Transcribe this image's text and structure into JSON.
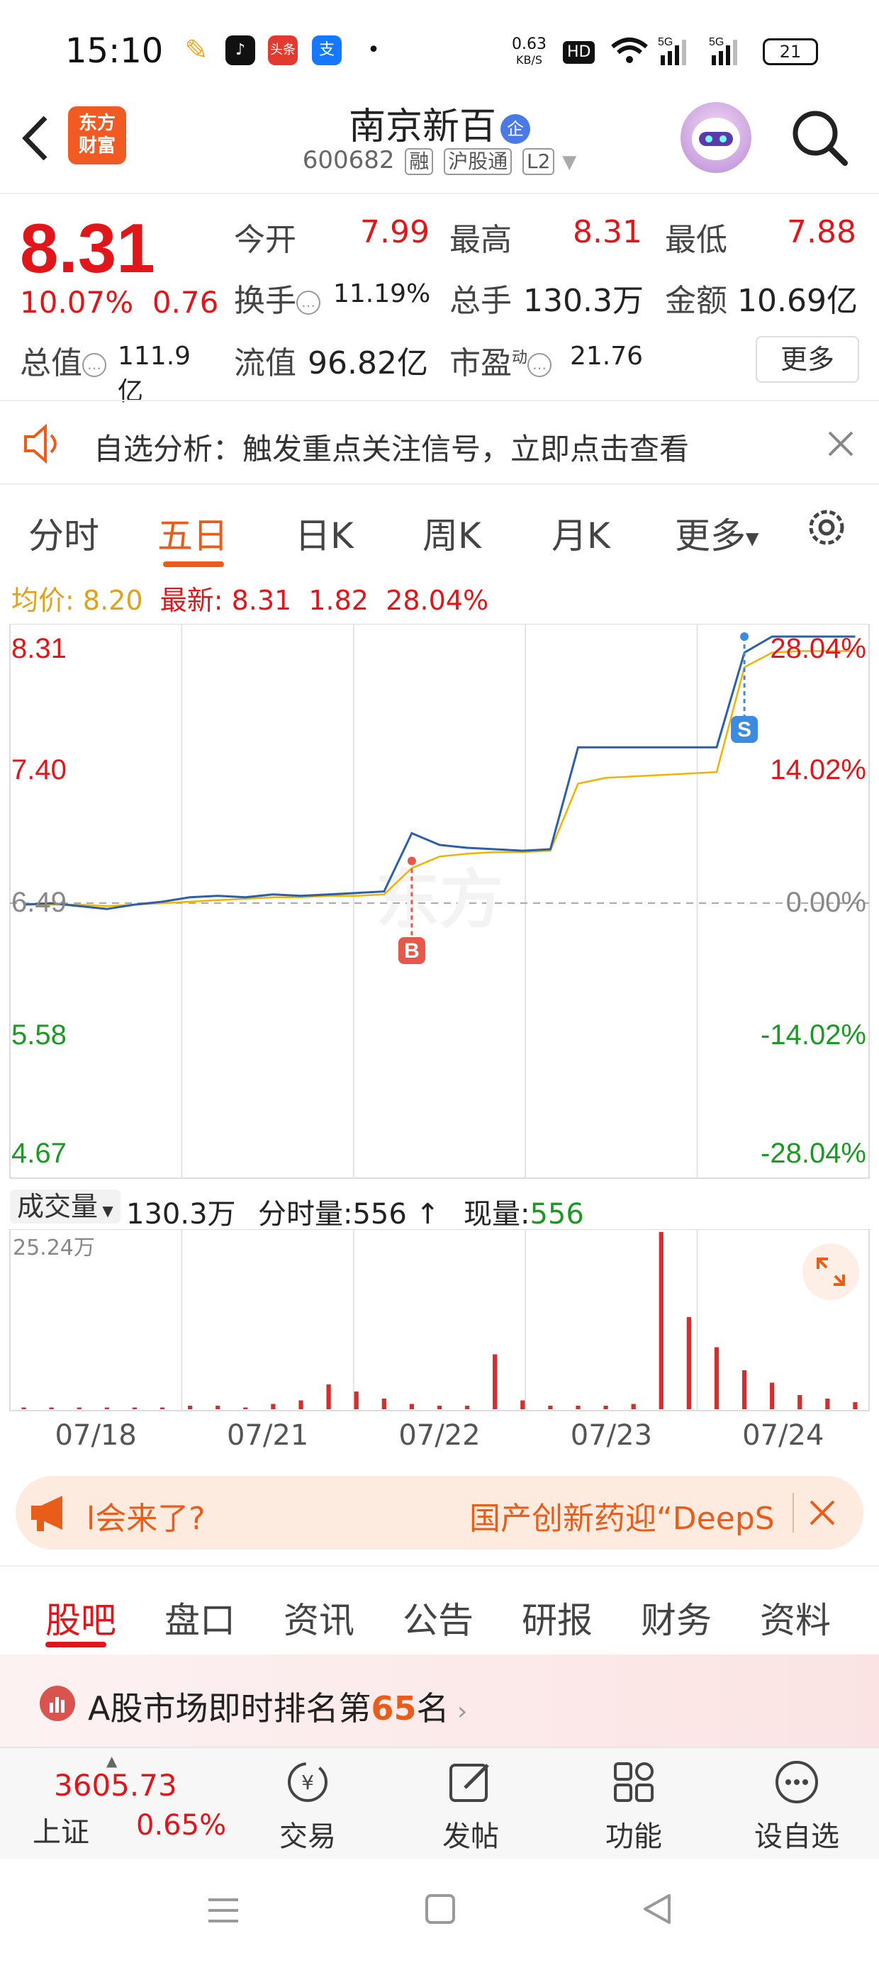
{
  "status_bar": {
    "time": "15:10",
    "net_speed": "0.63",
    "net_unit": "KB/S",
    "hd": "HD",
    "battery": "21",
    "app_icons": [
      "feather-icon",
      "tiktok-icon",
      "toutiao-icon",
      "alipay-icon"
    ],
    "toutiao_label": "头条",
    "alipay_label": "支"
  },
  "header": {
    "logo_line1": "东方",
    "logo_line2": "财富",
    "name": "南京新百",
    "name_badge": "企",
    "code": "600682",
    "tags": [
      "融",
      "沪股通",
      "L2"
    ]
  },
  "quote": {
    "price": "8.31",
    "change_pct": "10.07%",
    "change": "0.76",
    "open_label": "今开",
    "open": "7.99",
    "high_label": "最高",
    "high": "8.31",
    "low_label": "最低",
    "low": "7.88",
    "turnover_label": "换手",
    "turnover": "11.19%",
    "volume_label": "总手",
    "volume": "130.3万",
    "amount_label": "金额",
    "amount": "10.69亿",
    "mktcap_label": "总值",
    "mktcap": "111.9亿",
    "float_label": "流值",
    "float": "96.82亿",
    "pe_label": "市盈",
    "pe_sup": "动",
    "pe": "21.76",
    "more": "更多"
  },
  "notice": {
    "text": "自选分析：触发重点关注信号，立即点击查看"
  },
  "chart_tabs": {
    "items": [
      "分时",
      "五日",
      "日K",
      "周K",
      "月K",
      "更多"
    ],
    "active": "五日"
  },
  "avg_line": {
    "avg_label": "均价:",
    "avg": "8.20",
    "latest_label": "最新:",
    "latest": "8.31",
    "chg": "1.82",
    "pct": "28.04%"
  },
  "chart_data": {
    "type": "line",
    "x": [
      "07/18",
      "07/21",
      "07/22",
      "07/23",
      "07/24"
    ],
    "price_ticks": [
      "8.31",
      "7.40",
      "6.49",
      "5.58",
      "4.67"
    ],
    "pct_ticks": [
      "28.04%",
      "14.02%",
      "0.00%",
      "-14.02%",
      "-28.04%"
    ],
    "base": 6.49,
    "ylim": [
      4.67,
      8.31
    ],
    "series": [
      {
        "values": [
          6.47,
          6.48,
          6.46,
          6.44,
          6.47,
          6.49,
          6.52,
          6.53,
          6.52,
          6.54,
          6.53,
          6.54,
          6.55,
          6.56,
          6.96,
          6.88,
          6.86,
          6.85,
          6.84,
          6.85,
          7.55,
          7.55,
          7.55,
          7.55,
          7.55,
          7.55,
          8.2,
          8.31,
          8.31,
          8.31,
          8.31
        ]
      },
      {
        "values": [
          6.47,
          6.47,
          6.47,
          6.46,
          6.47,
          6.48,
          6.49,
          6.5,
          6.51,
          6.52,
          6.52,
          6.53,
          6.53,
          6.54,
          6.72,
          6.8,
          6.82,
          6.83,
          6.83,
          6.84,
          7.3,
          7.34,
          7.35,
          7.36,
          7.37,
          7.38,
          8.1,
          8.2,
          8.21,
          8.21,
          8.21
        ]
      }
    ],
    "markers": [
      {
        "label": "B",
        "price": 6.77
      },
      {
        "label": "S",
        "price": 8.31
      }
    ],
    "volume": {
      "label": "成交量",
      "total": "130.3万",
      "minute_label": "分时量:",
      "minute": "556",
      "current_label": "现量:",
      "current": "556",
      "max_label": "25.24万",
      "bars": [
        0.01,
        0.01,
        0.01,
        0.01,
        0.01,
        0.01,
        0.02,
        0.02,
        0.01,
        0.03,
        0.05,
        0.14,
        0.1,
        0.06,
        0.03,
        0.02,
        0.02,
        0.31,
        0.05,
        0.02,
        0.02,
        0.02,
        0.03,
        1.0,
        0.52,
        0.35,
        0.22,
        0.15,
        0.08,
        0.06,
        0.04
      ]
    }
  },
  "ad": {
    "left_text": "l会来了?",
    "right_text": "国产创新药迎“DeepS"
  },
  "bottom_tabs": {
    "items": [
      "股吧",
      "盘口",
      "资讯",
      "公告",
      "研报",
      "财务",
      "资料"
    ],
    "active": "股吧"
  },
  "rank": {
    "prefix": "A股市场即时排名第",
    "rank": "65",
    "suffix": "名"
  },
  "toolbar": {
    "index_value": "3605.73",
    "index_name": "上证",
    "index_pct": "0.65%",
    "items": [
      "交易",
      "发帖",
      "功能",
      "设自选"
    ]
  }
}
